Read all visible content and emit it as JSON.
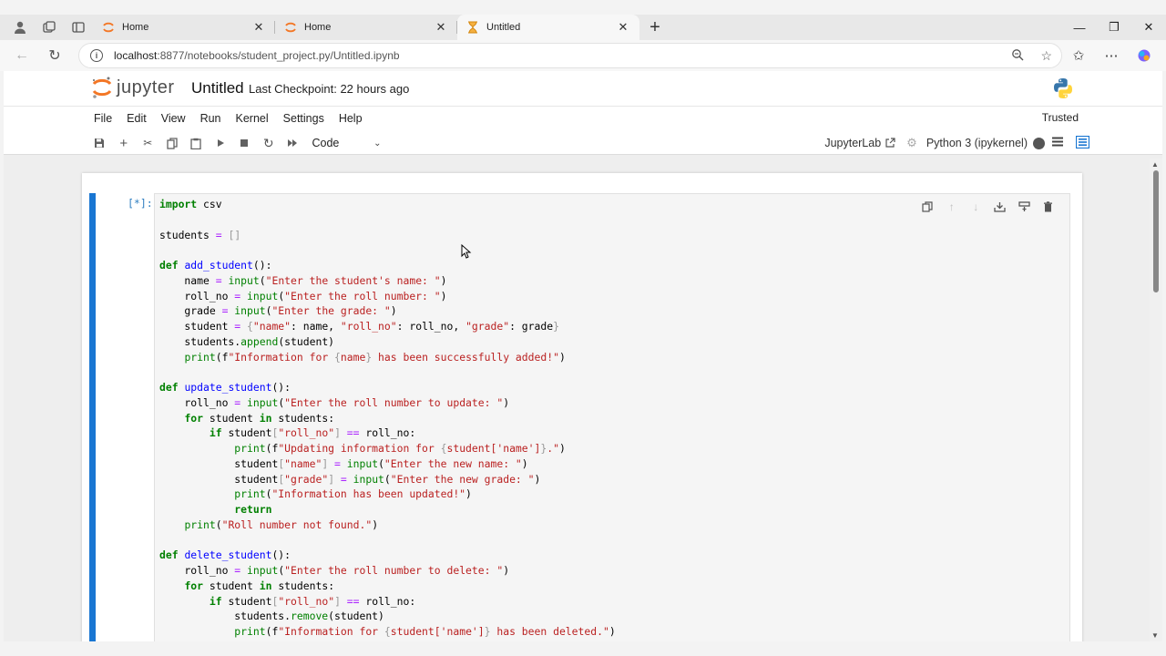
{
  "browser": {
    "tabs": [
      {
        "title": "Home",
        "active": false
      },
      {
        "title": "Home",
        "active": false
      },
      {
        "title": "Untitled",
        "active": true
      }
    ],
    "url_host": "localhost",
    "url_rest": ":8877/notebooks/student_project.py/Untitled.ipynb"
  },
  "jupyter": {
    "logo_text": "jupyter",
    "notebook_title": "Untitled",
    "checkpoint": "Last Checkpoint: 22 hours ago",
    "menu": [
      "File",
      "Edit",
      "View",
      "Run",
      "Kernel",
      "Settings",
      "Help"
    ],
    "trusted": "Trusted",
    "cell_type": "Code",
    "jupyterlab_link": "JupyterLab",
    "kernel_name": "Python 3 (ipykernel)"
  },
  "cell": {
    "prompt": "[*]:",
    "code_lines": [
      "import csv",
      "",
      "students = []",
      "",
      "def add_student():",
      "    name = input(\"Enter the student's name: \")",
      "    roll_no = input(\"Enter the roll number: \")",
      "    grade = input(\"Enter the grade: \")",
      "    student = {\"name\": name, \"roll_no\": roll_no, \"grade\": grade}",
      "    students.append(student)",
      "    print(f\"Information for {name} has been successfully added!\")",
      "",
      "def update_student():",
      "    roll_no = input(\"Enter the roll number to update: \")",
      "    for student in students:",
      "        if student[\"roll_no\"] == roll_no:",
      "            print(f\"Updating information for {student['name']}.\")",
      "            student[\"name\"] = input(\"Enter the new name: \")",
      "            student[\"grade\"] = input(\"Enter the new grade: \")",
      "            print(\"Information has been updated!\")",
      "            return",
      "    print(\"Roll number not found.\")",
      "",
      "def delete_student():",
      "    roll_no = input(\"Enter the roll number to delete: \")",
      "    for student in students:",
      "        if student[\"roll_no\"] == roll_no:",
      "            students.remove(student)",
      "            print(f\"Information for {student['name']} has been deleted.\")"
    ]
  },
  "colors": {
    "active_cell_bar": "#1976d2",
    "keyword": "#008000",
    "function_name": "#0000ff",
    "string": "#ba2121",
    "jupyter_orange": "#f37726"
  }
}
